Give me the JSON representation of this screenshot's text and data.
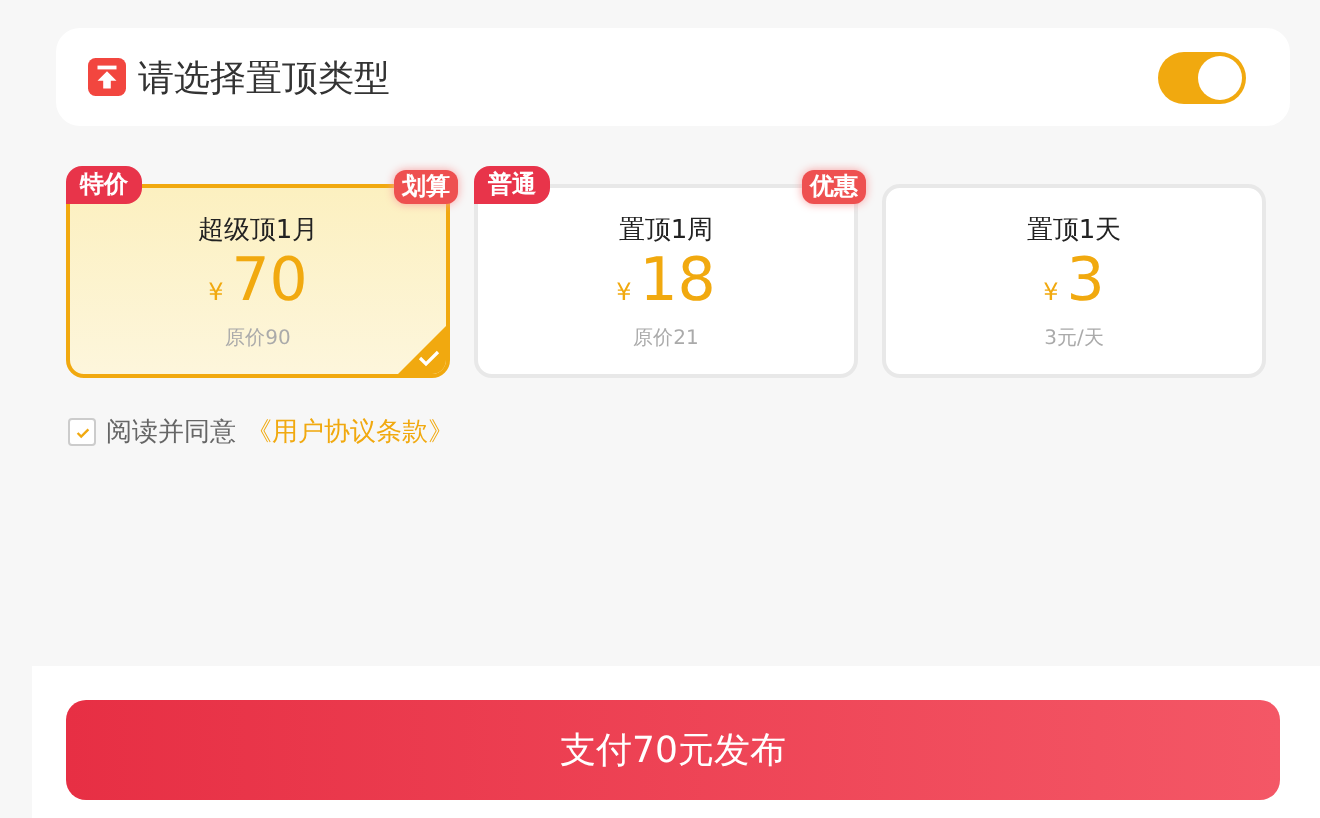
{
  "header": {
    "title": "请选择置顶类型",
    "toggle_on": true
  },
  "plans": [
    {
      "tag": "特价",
      "corner": "划算",
      "title": "超级顶1月",
      "currency": "¥",
      "price": "70",
      "note": "原价90",
      "selected": true
    },
    {
      "tag": "普通",
      "corner": "优惠",
      "title": "置顶1周",
      "currency": "¥",
      "price": "18",
      "note": "原价21",
      "selected": false
    },
    {
      "title": "置顶1天",
      "currency": "¥",
      "price": "3",
      "note": "3元/天",
      "selected": false
    }
  ],
  "agreement": {
    "checked": true,
    "text": "阅读并同意",
    "link": "《用户协议条款》"
  },
  "pay_button": "支付70元发布"
}
